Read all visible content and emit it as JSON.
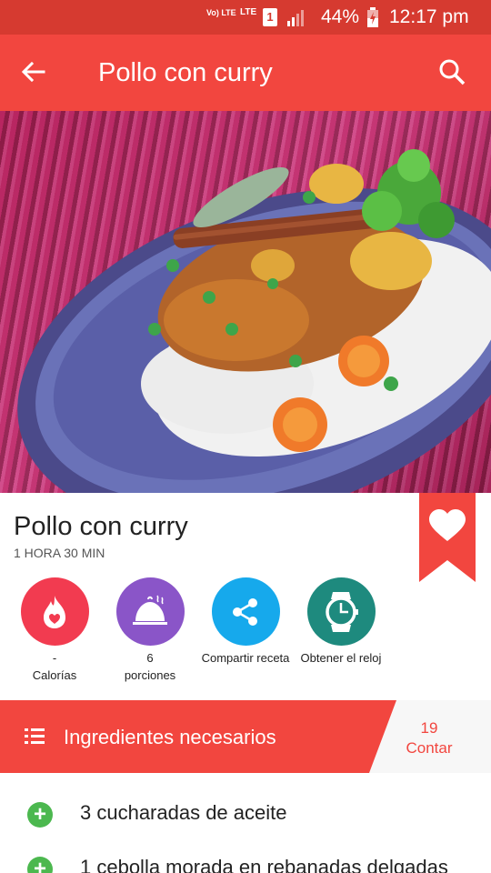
{
  "status_bar": {
    "volte": "Vo) LTE",
    "lte": "LTE",
    "sim": "1",
    "battery_percent": "44%",
    "time": "12:17 pm"
  },
  "app_bar": {
    "title": "Pollo con curry",
    "back_icon": "back-arrow-icon",
    "search_icon": "search-icon"
  },
  "hero": {
    "image": "curry-chicken-dish-photo"
  },
  "recipe": {
    "title": "Pollo con curry",
    "time": "1 HORA 30 MIN",
    "favorite_icon": "heart-icon"
  },
  "actions": {
    "calories": {
      "value": "-",
      "label": "Calorías",
      "icon": "flame-icon"
    },
    "portions": {
      "value": "6",
      "label": "porciones",
      "icon": "cloche-icon"
    },
    "share": {
      "label": "Compartir receta",
      "icon": "share-icon"
    },
    "clock": {
      "label": "Obtener el reloj",
      "icon": "watch-icon"
    }
  },
  "ingredients_header": {
    "title": "Ingredientes necesarios",
    "count": "19",
    "count_label": "Contar",
    "icon": "list-icon"
  },
  "ingredients": [
    {
      "text": "3 cucharadas de aceite"
    },
    {
      "text": "1 cebolla morada en rebanadas delgadas"
    }
  ],
  "colors": {
    "status_bar": "#d63a30",
    "app_bar": "#f2463f",
    "calories": "#f23b50",
    "portions": "#8a55c8",
    "share": "#16a9ec",
    "clock": "#1e8a7e",
    "add": "#4cb84f"
  }
}
